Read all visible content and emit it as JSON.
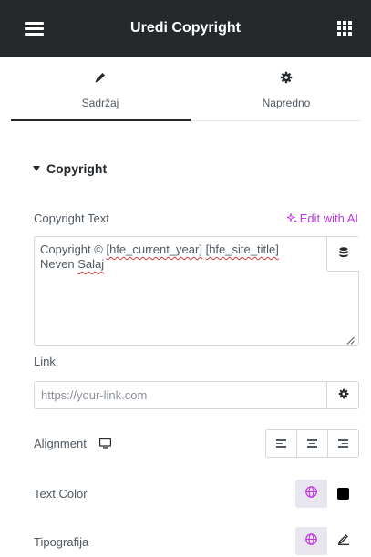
{
  "header": {
    "title": "Uredi Copyright",
    "menu_icon": "hamburger-icon",
    "apps_icon": "grid-icon"
  },
  "tabs": [
    {
      "label": "Sadržaj",
      "icon": "pencil-icon",
      "active": true
    },
    {
      "label": "Napredno",
      "icon": "gear-icon",
      "active": false
    }
  ],
  "section": {
    "title": "Copyright",
    "expanded": true
  },
  "copyright_text": {
    "label": "Copyright Text",
    "ai_label": "Edit with AI",
    "value": {
      "prefix": "Copyright © ",
      "token_year": "[hfe_current_year]",
      "token_title": "[hfe_site_title]",
      "name_first": "Neven",
      "name_last": "Salaj"
    },
    "dynamic_icon": "database-icon"
  },
  "link": {
    "label": "Link",
    "placeholder": "https://your-link.com",
    "settings_icon": "gear-icon"
  },
  "alignment": {
    "label": "Alignment",
    "device_icon": "desktop-icon",
    "options": [
      "left",
      "center",
      "right"
    ]
  },
  "text_color": {
    "label": "Text Color",
    "swatch": "#000000"
  },
  "typography": {
    "label": "Tipografija"
  },
  "colors": {
    "header_bg": "#26292c",
    "ai_accent": "#c036e1",
    "global_accent": "#c036e1",
    "global_bg": "#e9e6ef"
  }
}
